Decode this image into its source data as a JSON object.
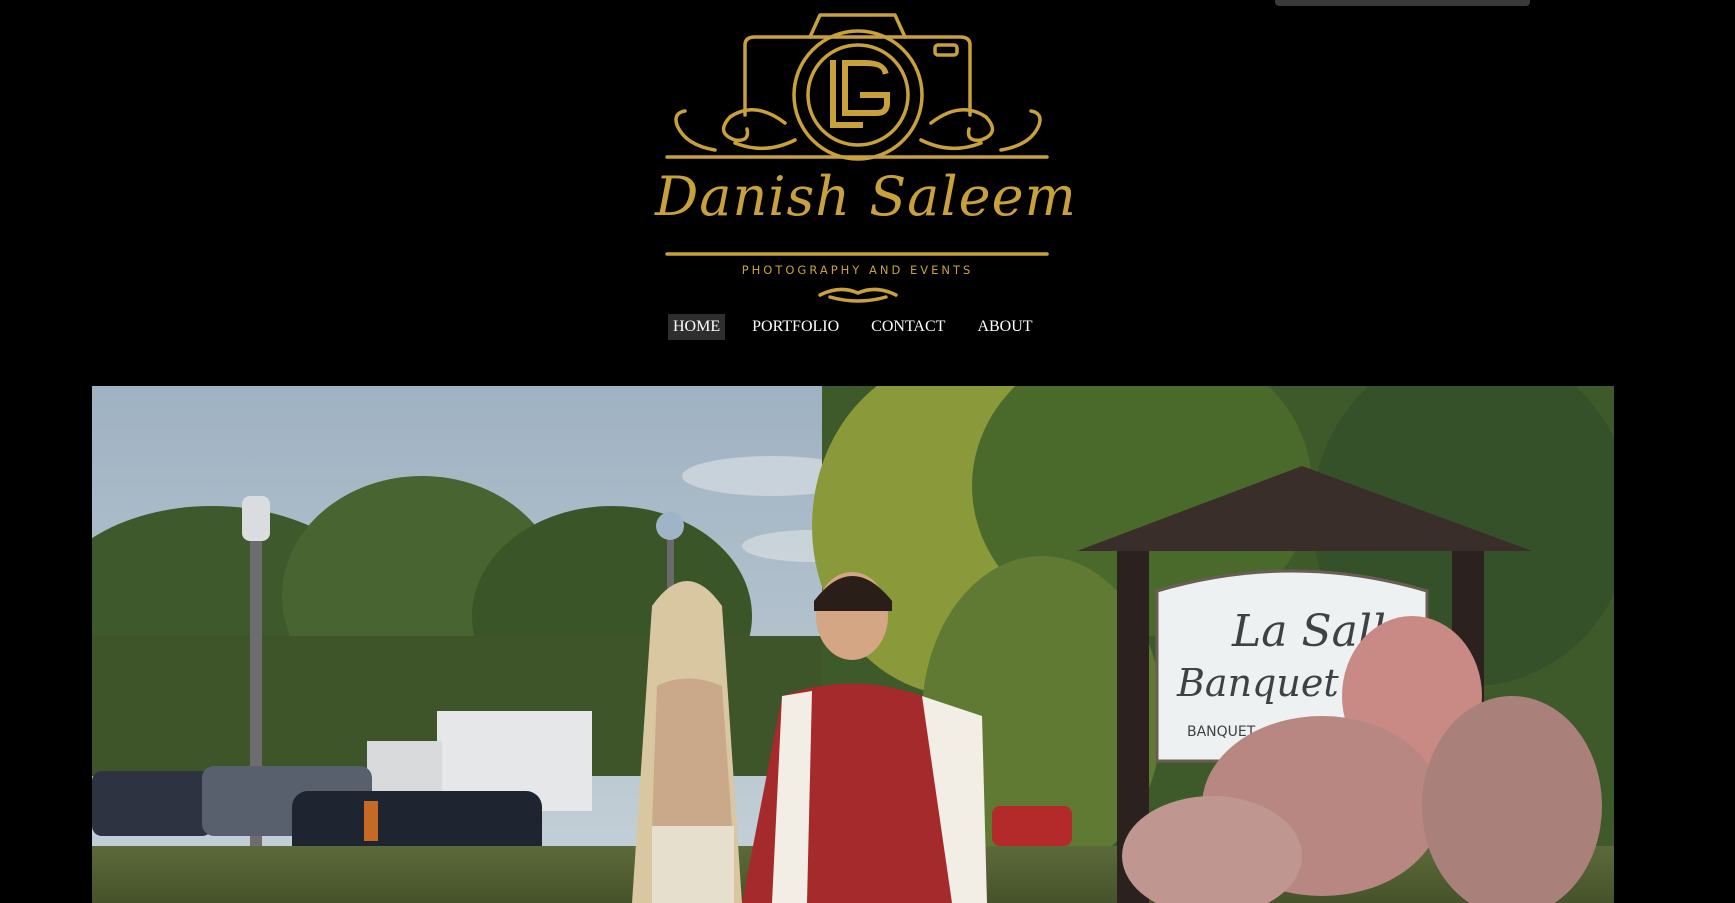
{
  "brand": {
    "name": "Danish Saleem",
    "tagline": "PHOTOGRAPHY AND EVENTS",
    "logo_icon": "camera-monogram-icon",
    "accent": "#c9a13b"
  },
  "nav": {
    "items": [
      {
        "label": "HOME",
        "active": true
      },
      {
        "label": "PORTFOLIO",
        "active": false
      },
      {
        "label": "CONTACT",
        "active": false
      },
      {
        "label": "ABOUT",
        "active": false
      }
    ]
  },
  "hero": {
    "sign_line1": "La Salle",
    "sign_line2": "Banquet C",
    "sign_line3": "BANQUET"
  },
  "colors": {
    "background": "#000000",
    "nav_text": "#ffffff",
    "nav_active_bg": "#2e2e2e"
  }
}
